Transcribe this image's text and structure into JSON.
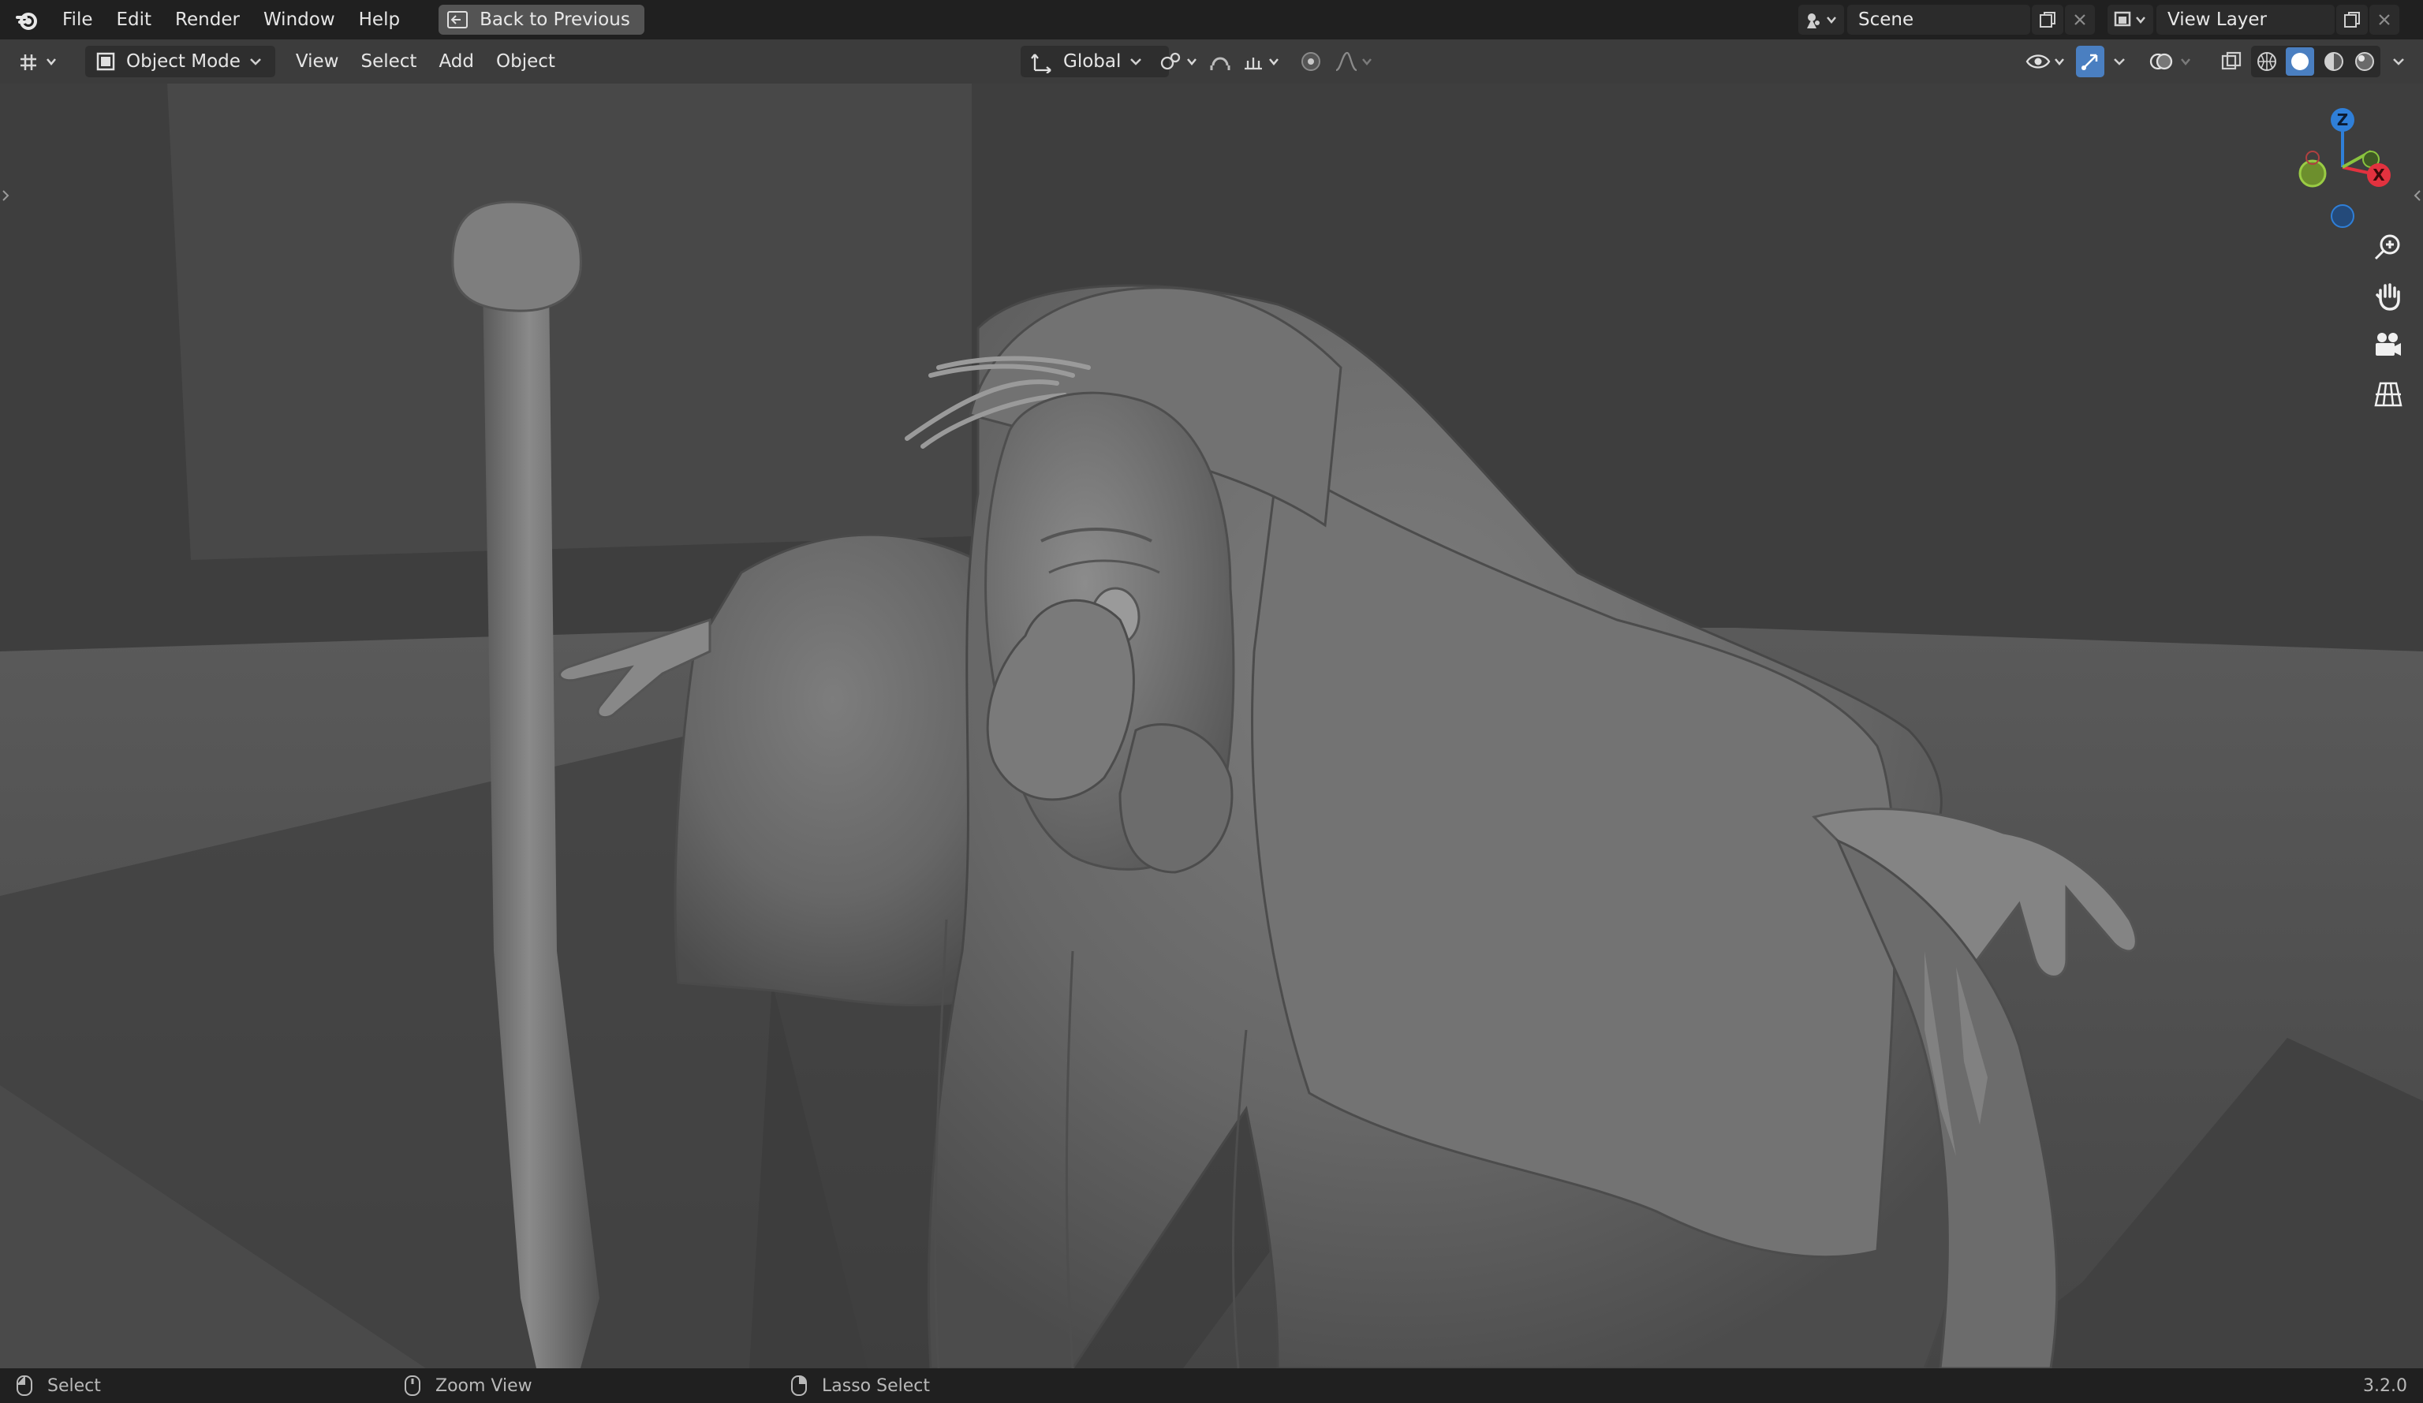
{
  "topbar": {
    "menu": [
      "File",
      "Edit",
      "Render",
      "Window",
      "Help"
    ],
    "back_button": "Back to Previous",
    "scene_name": "Scene",
    "view_layer_name": "View Layer"
  },
  "header": {
    "mode": "Object Mode",
    "menus": [
      "View",
      "Select",
      "Add",
      "Object"
    ],
    "transform_orientation": "Global"
  },
  "gizmo": {
    "z_label": "Z",
    "x_label": "X"
  },
  "statusbar": {
    "select": "Select",
    "zoom": "Zoom View",
    "lasso": "Lasso Select",
    "version": "3.2.0"
  },
  "colors": {
    "topbar_bg": "#202020",
    "header_bg": "#3c3c3c",
    "x_axis": "#e2323f",
    "y_axis": "#8ac43e",
    "z_axis": "#2f7fd8",
    "active_blue": "#4a7fc1"
  },
  "icons": [
    "blender-logo-icon",
    "back-arrow-icon",
    "scene-icon",
    "view-layer-icon",
    "editor-type-icon",
    "object-mode-icon",
    "transform-orientation-icon",
    "pivot-icon",
    "snap-icon",
    "proportional-edit-icon",
    "visibility-icon",
    "gizmo-icon",
    "overlay-icon",
    "xray-icon",
    "shading-wireframe-icon",
    "shading-solid-icon",
    "shading-material-icon",
    "shading-rendered-icon",
    "zoom-icon",
    "hand-icon",
    "camera-icon",
    "grid-icon",
    "mouse-icon"
  ]
}
